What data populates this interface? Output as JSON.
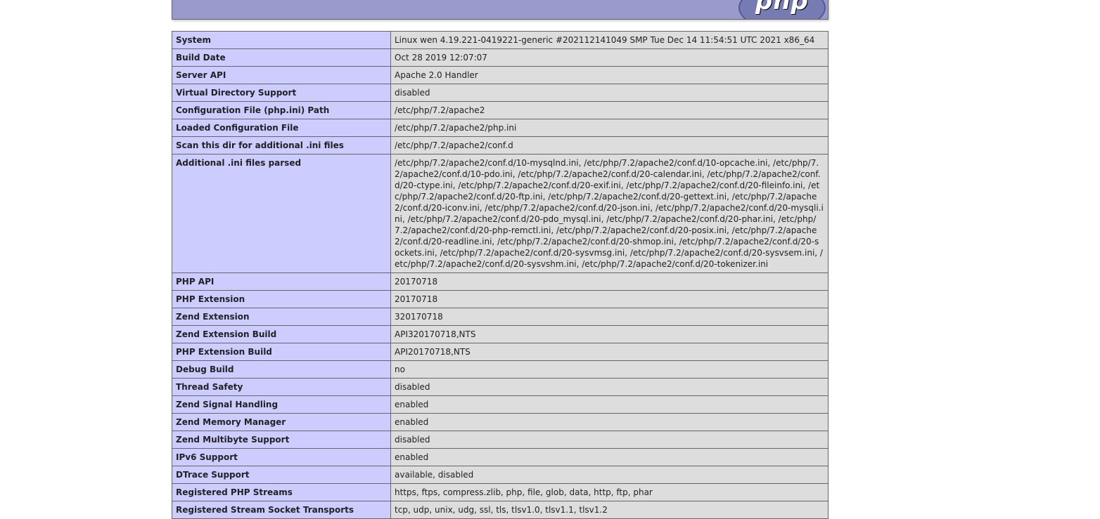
{
  "header": {
    "logo_text": "php",
    "colors": {
      "header_bg": "#9999cc",
      "key_bg": "#ccccff",
      "value_bg": "#dddddd",
      "border": "#666666"
    }
  },
  "rows": [
    {
      "key": "System",
      "value": "Linux wen 4.19.221-0419221-generic #202112141049 SMP Tue Dec 14 11:54:51 UTC 2021 x86_64"
    },
    {
      "key": "Build Date",
      "value": "Oct 28 2019 12:07:07"
    },
    {
      "key": "Server API",
      "value": "Apache 2.0 Handler"
    },
    {
      "key": "Virtual Directory Support",
      "value": "disabled"
    },
    {
      "key": "Configuration File (php.ini) Path",
      "value": "/etc/php/7.2/apache2"
    },
    {
      "key": "Loaded Configuration File",
      "value": "/etc/php/7.2/apache2/php.ini"
    },
    {
      "key": "Scan this dir for additional .ini files",
      "value": "/etc/php/7.2/apache2/conf.d"
    },
    {
      "key": "Additional .ini files parsed",
      "value": "/etc/php/7.2/apache2/conf.d/10-mysqlnd.ini, /etc/php/7.2/apache2/conf.d/10-opcache.ini, /etc/php/7.2/apache2/conf.d/10-pdo.ini, /etc/php/7.2/apache2/conf.d/20-calendar.ini, /etc/php/7.2/apache2/conf.d/20-ctype.ini, /etc/php/7.2/apache2/conf.d/20-exif.ini, /etc/php/7.2/apache2/conf.d/20-fileinfo.ini, /etc/php/7.2/apache2/conf.d/20-ftp.ini, /etc/php/7.2/apache2/conf.d/20-gettext.ini, /etc/php/7.2/apache2/conf.d/20-iconv.ini, /etc/php/7.2/apache2/conf.d/20-json.ini, /etc/php/7.2/apache2/conf.d/20-mysqli.ini, /etc/php/7.2/apache2/conf.d/20-pdo_mysql.ini, /etc/php/7.2/apache2/conf.d/20-phar.ini, /etc/php/7.2/apache2/conf.d/20-php-remctl.ini, /etc/php/7.2/apache2/conf.d/20-posix.ini, /etc/php/7.2/apache2/conf.d/20-readline.ini, /etc/php/7.2/apache2/conf.d/20-shmop.ini, /etc/php/7.2/apache2/conf.d/20-sockets.ini, /etc/php/7.2/apache2/conf.d/20-sysvmsg.ini, /etc/php/7.2/apache2/conf.d/20-sysvsem.ini, /etc/php/7.2/apache2/conf.d/20-sysvshm.ini, /etc/php/7.2/apache2/conf.d/20-tokenizer.ini"
    },
    {
      "key": "PHP API",
      "value": "20170718"
    },
    {
      "key": "PHP Extension",
      "value": "20170718"
    },
    {
      "key": "Zend Extension",
      "value": "320170718"
    },
    {
      "key": "Zend Extension Build",
      "value": "API320170718,NTS"
    },
    {
      "key": "PHP Extension Build",
      "value": "API20170718,NTS"
    },
    {
      "key": "Debug Build",
      "value": "no"
    },
    {
      "key": "Thread Safety",
      "value": "disabled"
    },
    {
      "key": "Zend Signal Handling",
      "value": "enabled"
    },
    {
      "key": "Zend Memory Manager",
      "value": "enabled"
    },
    {
      "key": "Zend Multibyte Support",
      "value": "disabled"
    },
    {
      "key": "IPv6 Support",
      "value": "enabled"
    },
    {
      "key": "DTrace Support",
      "value": "available, disabled"
    },
    {
      "key": "Registered PHP Streams",
      "value": "https, ftps, compress.zlib, php, file, glob, data, http, ftp, phar"
    },
    {
      "key": "Registered Stream Socket Transports",
      "value": "tcp, udp, unix, udg, ssl, tls, tlsv1.0, tlsv1.1, tlsv1.2"
    }
  ]
}
